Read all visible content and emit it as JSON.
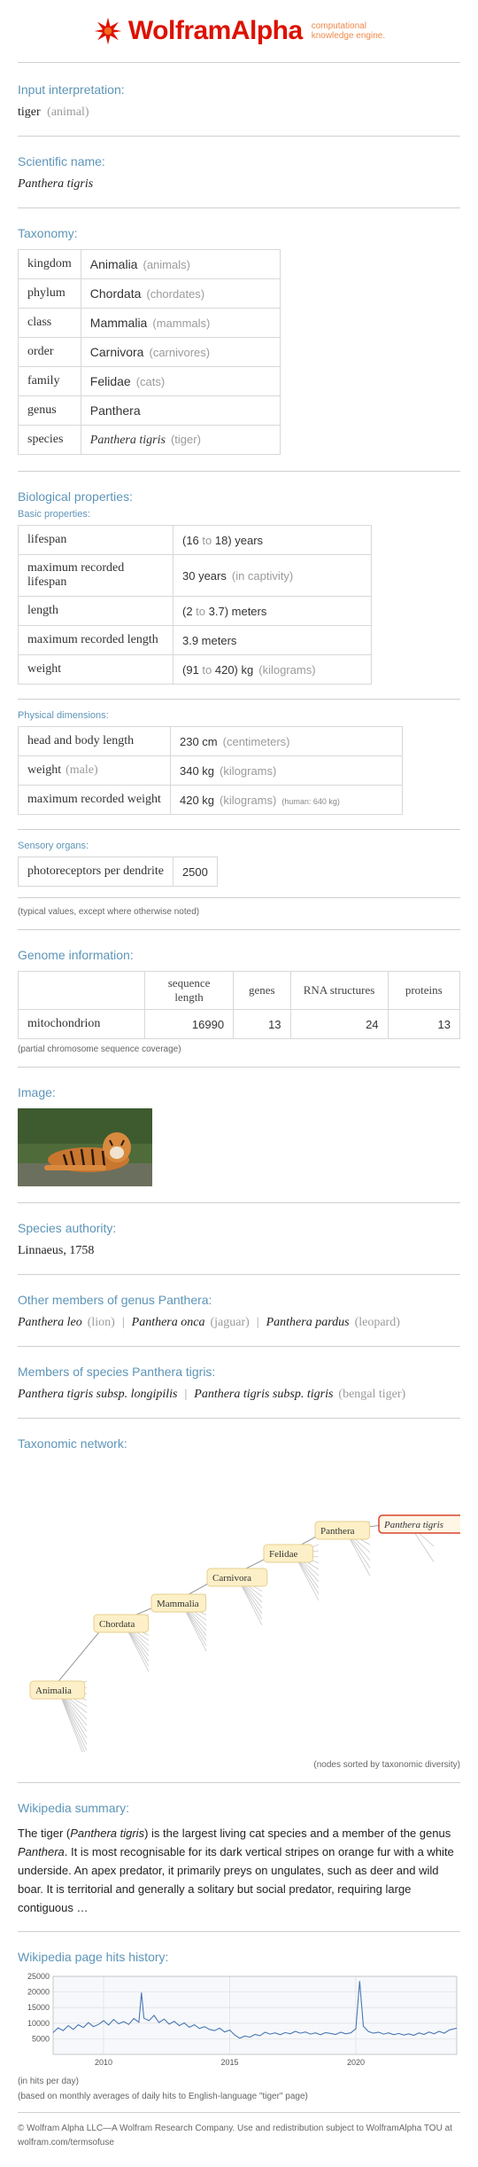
{
  "brand": {
    "wolfram": "Wolfram",
    "alpha": "Alpha",
    "tagline_1": "computational",
    "tagline_2": "knowledge engine."
  },
  "input": {
    "title": "Input interpretation:",
    "term": "tiger",
    "qualifier": "(animal)"
  },
  "scientific": {
    "title": "Scientific name:",
    "name": "Panthera tigris"
  },
  "taxonomy": {
    "title": "Taxonomy:",
    "rows": [
      {
        "rank": "kingdom",
        "value": "Animalia",
        "common": "(animals)",
        "italic": false
      },
      {
        "rank": "phylum",
        "value": "Chordata",
        "common": "(chordates)",
        "italic": false
      },
      {
        "rank": "class",
        "value": "Mammalia",
        "common": "(mammals)",
        "italic": false
      },
      {
        "rank": "order",
        "value": "Carnivora",
        "common": "(carnivores)",
        "italic": false
      },
      {
        "rank": "family",
        "value": "Felidae",
        "common": "(cats)",
        "italic": false
      },
      {
        "rank": "genus",
        "value": "Panthera",
        "common": "",
        "italic": false
      },
      {
        "rank": "species",
        "value": "Panthera tigris",
        "common": "(tiger)",
        "italic": true
      }
    ]
  },
  "bio": {
    "title": "Biological properties:",
    "basic_title": "Basic properties:",
    "basic_rows": [
      {
        "label": "lifespan",
        "value": "(16 to 18) years",
        "extra": ""
      },
      {
        "label": "maximum recorded lifespan",
        "value": "30 years",
        "extra": "(in captivity)"
      },
      {
        "label": "length",
        "value": "(2 to 3.7) meters",
        "extra": ""
      },
      {
        "label": "maximum recorded length",
        "value": "3.9 meters",
        "extra": ""
      },
      {
        "label": "weight",
        "value": "(91 to 420) kg",
        "extra": "(kilograms)"
      }
    ],
    "phys_title": "Physical dimensions:",
    "phys_rows": [
      {
        "label": "head and body length",
        "qual": "",
        "value": "230 cm",
        "extra": "(centimeters)",
        "note": ""
      },
      {
        "label": "weight",
        "qual": "(male)",
        "value": "340 kg",
        "extra": "(kilograms)",
        "note": ""
      },
      {
        "label": "maximum recorded weight",
        "qual": "",
        "value": "420 kg",
        "extra": "(kilograms)",
        "note": "(human: 640 kg)"
      }
    ],
    "sensory_title": "Sensory organs:",
    "sensory_rows": [
      {
        "label": "photoreceptors per dendrite",
        "value": "2500"
      }
    ],
    "note": "(typical values, except where otherwise noted)"
  },
  "genome": {
    "title": "Genome information:",
    "headers": [
      "",
      "sequence length",
      "genes",
      "RNA structures",
      "proteins"
    ],
    "row": [
      "mitochondrion",
      "16990",
      "13",
      "24",
      "13"
    ],
    "note": "(partial chromosome sequence coverage)"
  },
  "image": {
    "title": "Image:"
  },
  "authority": {
    "title": "Species authority:",
    "value": "Linnaeus, 1758"
  },
  "genus_members": {
    "title": "Other members of genus Panthera:",
    "items": [
      {
        "name": "Panthera leo",
        "common": "(lion)"
      },
      {
        "name": "Panthera onca",
        "common": "(jaguar)"
      },
      {
        "name": "Panthera pardus",
        "common": "(leopard)"
      }
    ]
  },
  "species_members": {
    "title": "Members of species Panthera tigris:",
    "items": [
      {
        "name": "Panthera tigris subsp. longipilis",
        "common": ""
      },
      {
        "name": "Panthera tigris subsp. tigris",
        "common": "(bengal tiger)"
      }
    ]
  },
  "network": {
    "title": "Taxonomic network:",
    "nodes": [
      "Animalia",
      "Chordata",
      "Mammalia",
      "Carnivora",
      "Felidae",
      "Panthera",
      "Panthera tigris"
    ],
    "note": "(nodes sorted by taxonomic diversity)"
  },
  "wiki": {
    "title": "Wikipedia summary:",
    "p1": "The tiger (",
    "p1_it": "Panthera tigris",
    "p2": ") is the largest living cat species and a member of the genus ",
    "p2_it": "Panthera",
    "p3": ". It is most recognisable for its dark vertical stripes on orange fur with a white underside. An apex predator, it primarily preys on ungulates, such as deer and wild boar. It is territorial and generally a solitary but social predator, requiring large contiguous …"
  },
  "hits": {
    "title": "Wikipedia page hits history:",
    "note1": "(in hits per day)",
    "note2": "(based on monthly averages of daily hits to English-language \"tiger\" page)"
  },
  "chart_data": {
    "type": "line",
    "title": "",
    "ylim": [
      0,
      25000
    ],
    "yticks": [
      "25000",
      "20000",
      "15000",
      "10000",
      "5000"
    ],
    "ytick_values": [
      25000,
      20000,
      15000,
      10000,
      5000
    ],
    "xticks": [
      "2010",
      "2015",
      "2020"
    ],
    "xtick_values": [
      2010,
      2015,
      2020
    ],
    "x_range": [
      2008.0,
      2024.0
    ],
    "color": "#4a78b4",
    "series": [
      {
        "values": [
          [
            2008.0,
            7000
          ],
          [
            2008.2,
            8500
          ],
          [
            2008.4,
            7600
          ],
          [
            2008.6,
            9200
          ],
          [
            2008.8,
            8000
          ],
          [
            2009.0,
            9500
          ],
          [
            2009.2,
            8600
          ],
          [
            2009.4,
            10200
          ],
          [
            2009.6,
            8900
          ],
          [
            2009.8,
            9600
          ],
          [
            2010.0,
            10800
          ],
          [
            2010.2,
            9400
          ],
          [
            2010.4,
            11200
          ],
          [
            2010.6,
            9800
          ],
          [
            2010.8,
            10500
          ],
          [
            2011.0,
            9600
          ],
          [
            2011.2,
            11500
          ],
          [
            2011.4,
            10300
          ],
          [
            2011.5,
            19800
          ],
          [
            2011.6,
            11600
          ],
          [
            2011.8,
            10800
          ],
          [
            2012.0,
            12500
          ],
          [
            2012.2,
            10200
          ],
          [
            2012.4,
            11300
          ],
          [
            2012.6,
            9700
          ],
          [
            2012.8,
            10600
          ],
          [
            2013.0,
            9200
          ],
          [
            2013.2,
            10100
          ],
          [
            2013.4,
            8700
          ],
          [
            2013.6,
            9500
          ],
          [
            2013.8,
            8300
          ],
          [
            2014.0,
            8900
          ],
          [
            2014.2,
            8000
          ],
          [
            2014.4,
            7600
          ],
          [
            2014.6,
            8400
          ],
          [
            2014.8,
            7200
          ],
          [
            2015.0,
            7800
          ],
          [
            2015.2,
            6200
          ],
          [
            2015.4,
            5200
          ],
          [
            2015.6,
            5900
          ],
          [
            2015.8,
            5500
          ],
          [
            2016.0,
            6400
          ],
          [
            2016.2,
            6000
          ],
          [
            2016.4,
            7100
          ],
          [
            2016.6,
            6500
          ],
          [
            2016.8,
            6900
          ],
          [
            2017.0,
            6300
          ],
          [
            2017.2,
            7000
          ],
          [
            2017.4,
            6600
          ],
          [
            2017.6,
            7400
          ],
          [
            2017.8,
            6800
          ],
          [
            2018.0,
            7200
          ],
          [
            2018.2,
            6500
          ],
          [
            2018.4,
            6900
          ],
          [
            2018.6,
            6300
          ],
          [
            2018.8,
            7000
          ],
          [
            2019.0,
            6700
          ],
          [
            2019.2,
            6400
          ],
          [
            2019.4,
            7100
          ],
          [
            2019.6,
            6600
          ],
          [
            2019.8,
            6900
          ],
          [
            2020.0,
            8200
          ],
          [
            2020.15,
            23500
          ],
          [
            2020.3,
            9000
          ],
          [
            2020.5,
            7300
          ],
          [
            2020.7,
            6800
          ],
          [
            2020.9,
            7100
          ],
          [
            2021.1,
            6500
          ],
          [
            2021.3,
            6900
          ],
          [
            2021.5,
            6300
          ],
          [
            2021.7,
            6700
          ],
          [
            2021.9,
            6200
          ],
          [
            2022.1,
            6600
          ],
          [
            2022.3,
            6100
          ],
          [
            2022.5,
            6900
          ],
          [
            2022.7,
            6400
          ],
          [
            2022.9,
            7200
          ],
          [
            2023.1,
            6600
          ],
          [
            2023.3,
            7400
          ],
          [
            2023.5,
            6800
          ],
          [
            2023.7,
            7800
          ],
          [
            2024.0,
            8400
          ]
        ]
      }
    ]
  },
  "footer": {
    "line1": "© Wolfram Alpha LLC—A Wolfram Research Company. Use and redistribution subject to WolframAlpha TOU at",
    "line2": "wolfram.com/termsofuse"
  }
}
